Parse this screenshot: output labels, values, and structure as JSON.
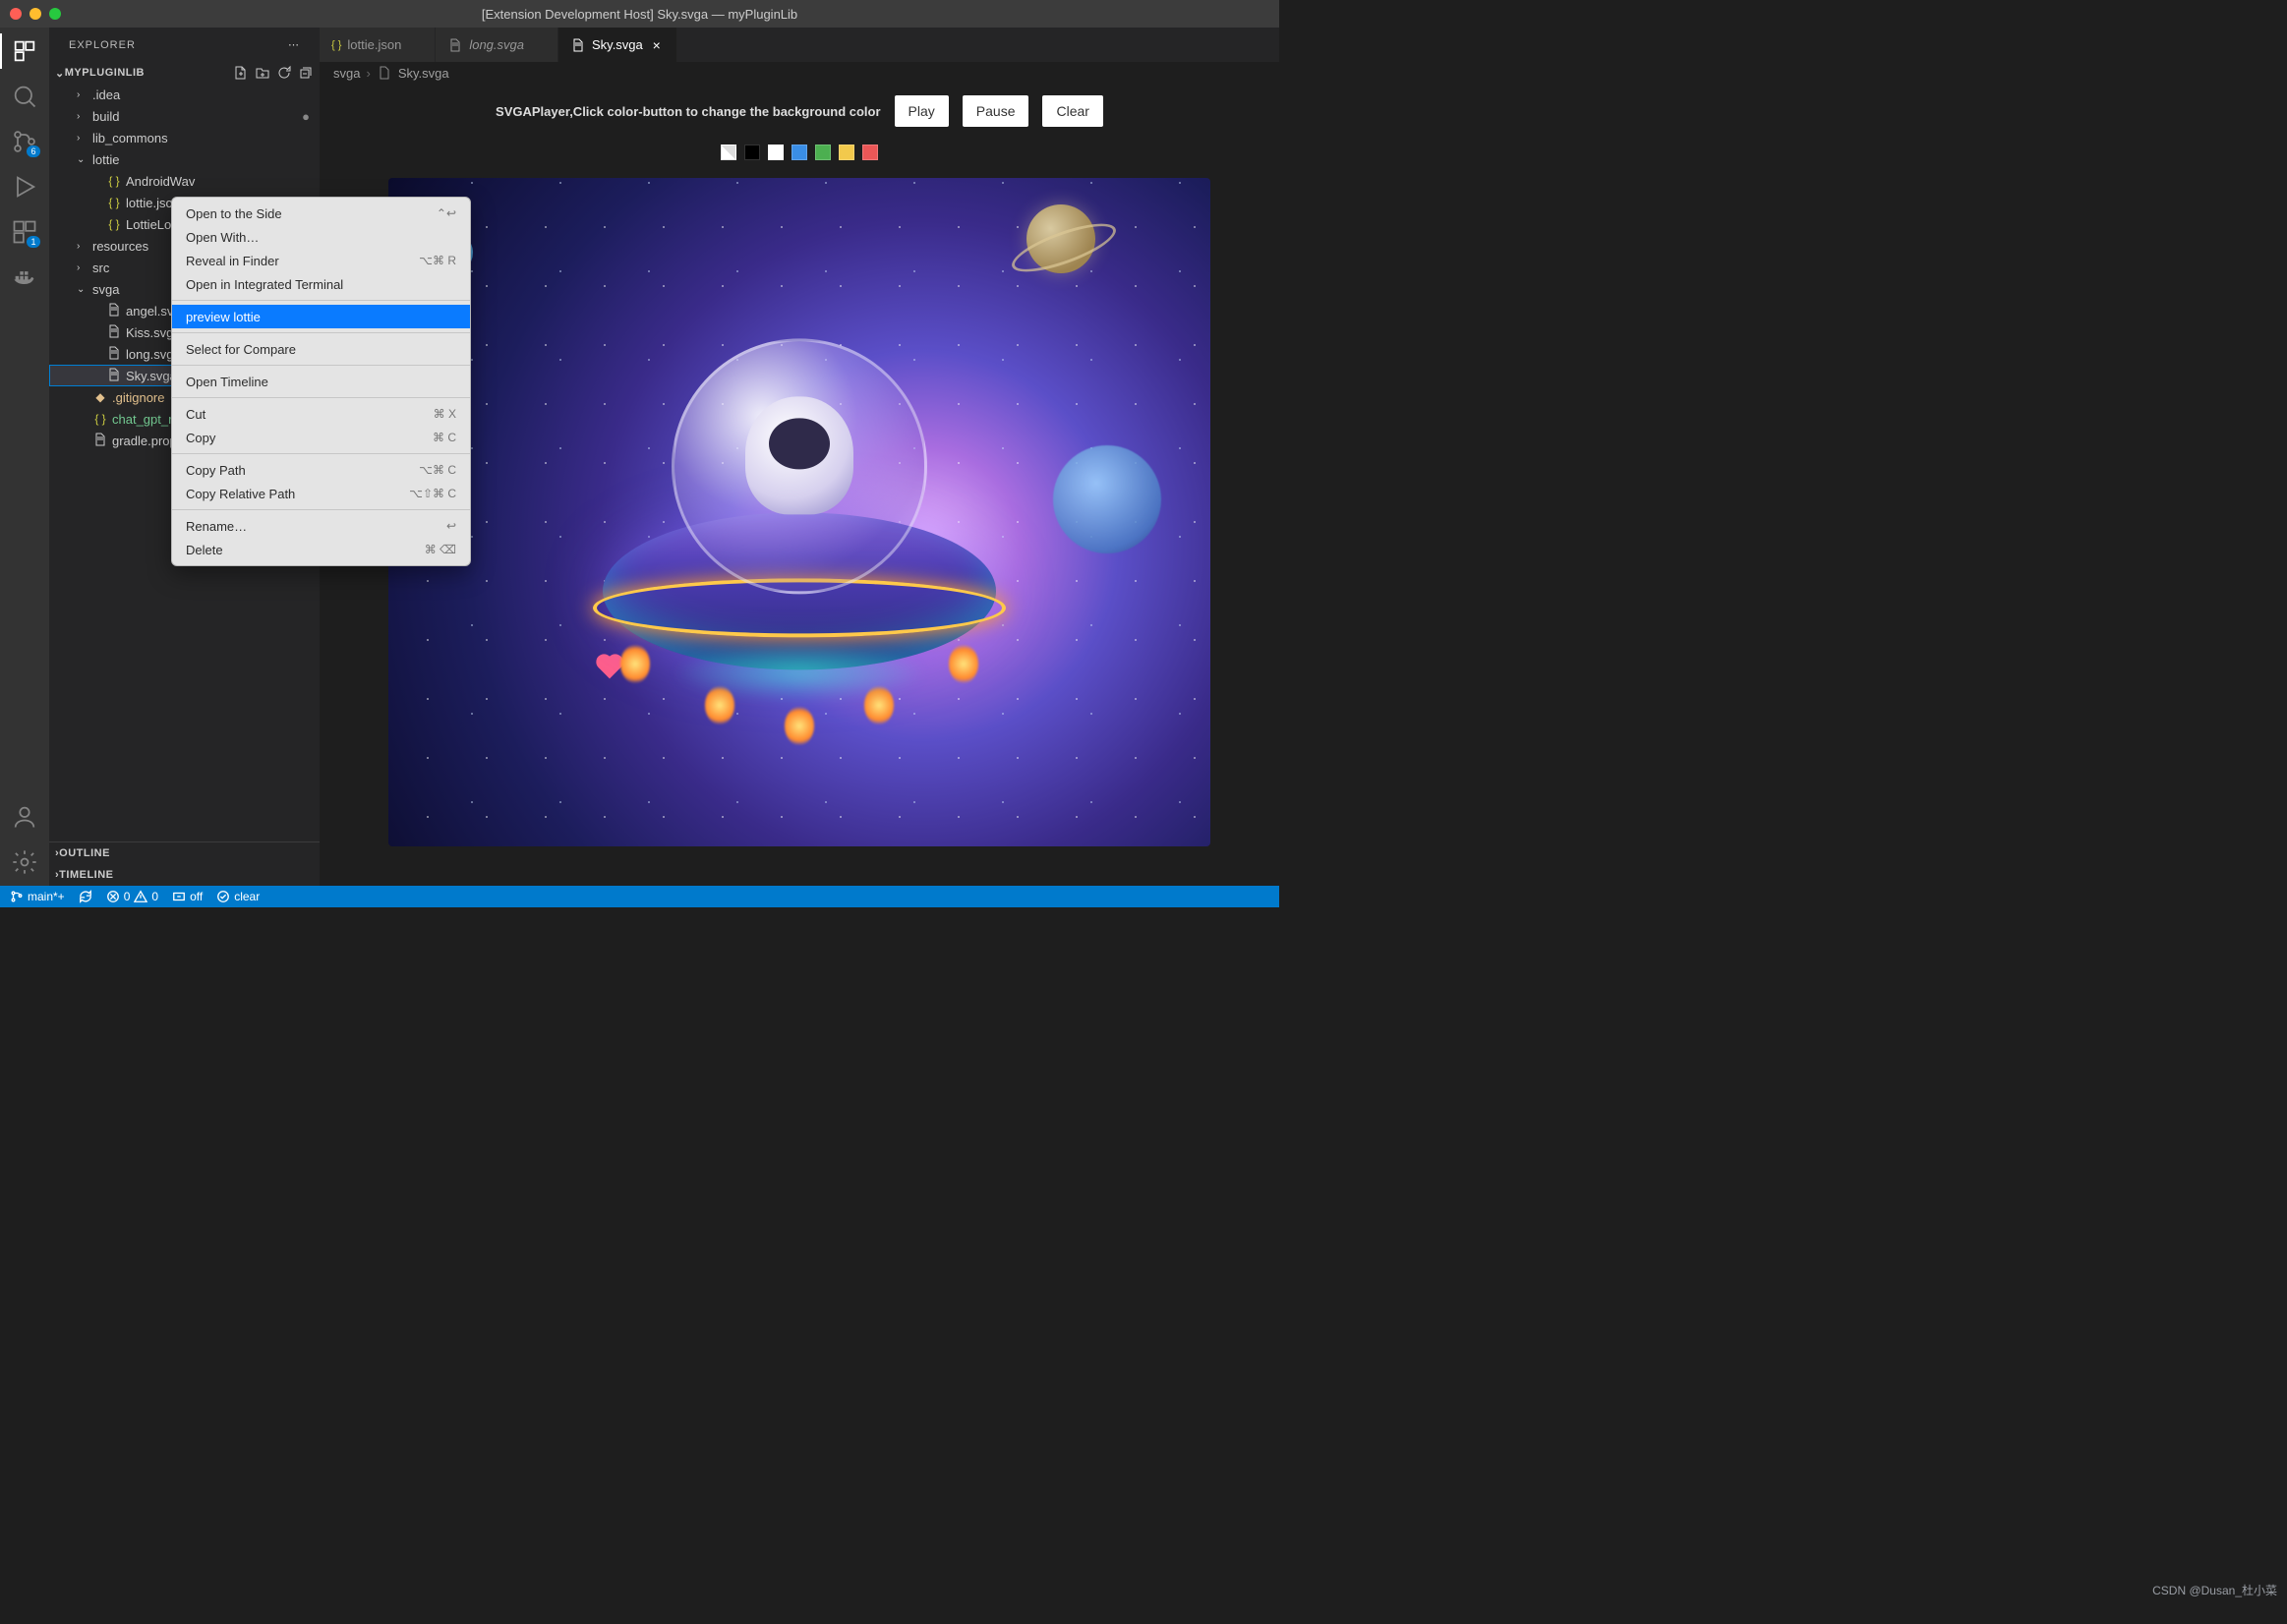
{
  "title": "[Extension Development Host] Sky.svga — myPluginLib",
  "sidebar": {
    "title": "EXPLORER",
    "project": "MYPLUGINLIB",
    "outline": "OUTLINE",
    "timeline": "TIMELINE",
    "tree": [
      {
        "label": ".idea",
        "type": "folder",
        "indent": 1
      },
      {
        "label": "build",
        "type": "folder",
        "indent": 1,
        "modified": true
      },
      {
        "label": "lib_commons",
        "type": "folder",
        "indent": 1
      },
      {
        "label": "lottie",
        "type": "folder-open",
        "indent": 1
      },
      {
        "label": "AndroidWave.json",
        "type": "json",
        "indent": 2,
        "truncated": "AndroidWav"
      },
      {
        "label": "lottie.json",
        "type": "json",
        "indent": 2
      },
      {
        "label": "LottieLogo1.json",
        "type": "json",
        "indent": 2,
        "truncated": "LottieLogo1"
      },
      {
        "label": "resources",
        "type": "folder",
        "indent": 1
      },
      {
        "label": "src",
        "type": "folder",
        "indent": 1
      },
      {
        "label": "svga",
        "type": "folder-open",
        "indent": 1
      },
      {
        "label": "angel.svga",
        "type": "file",
        "indent": 2
      },
      {
        "label": "Kiss.svga",
        "type": "file",
        "indent": 2
      },
      {
        "label": "long.svga",
        "type": "file",
        "indent": 2
      },
      {
        "label": "Sky.svga",
        "type": "file",
        "indent": 2,
        "selected": true
      },
      {
        "label": ".gitignore",
        "type": "git",
        "indent": 1,
        "color": "orange"
      },
      {
        "label": "chat_gpt_response.json",
        "type": "json",
        "indent": 1,
        "color": "green",
        "truncated": "chat_gpt_res"
      },
      {
        "label": "gradle.properties",
        "type": "file",
        "indent": 1,
        "truncated": "gradle.prope"
      }
    ]
  },
  "activity": {
    "scm_badge": "6",
    "ext_badge": "1"
  },
  "tabs": [
    {
      "label": "lottie.json",
      "icon": "json"
    },
    {
      "label": "long.svga",
      "icon": "file",
      "italic": true
    },
    {
      "label": "Sky.svga",
      "icon": "file",
      "active": true
    }
  ],
  "breadcrumb": {
    "parts": [
      "svga",
      "Sky.svga"
    ]
  },
  "player": {
    "text": "SVGAPlayer,Click color-button to change the background color",
    "play": "Play",
    "pause": "Pause",
    "clear": "Clear",
    "swatches": [
      "#ffffff",
      "#000000",
      "#ffffff",
      "#3a8ee6",
      "#4caf50",
      "#f2c94c",
      "#eb5757"
    ]
  },
  "context_menu": [
    {
      "label": "Open to the Side",
      "shortcut": "⌃↩"
    },
    {
      "label": "Open With…"
    },
    {
      "label": "Reveal in Finder",
      "shortcut": "⌥⌘ R"
    },
    {
      "label": "Open in Integrated Terminal"
    },
    {
      "sep": true
    },
    {
      "label": "preview lottie",
      "highlight": true
    },
    {
      "sep": true
    },
    {
      "label": "Select for Compare"
    },
    {
      "sep": true
    },
    {
      "label": "Open Timeline"
    },
    {
      "sep": true
    },
    {
      "label": "Cut",
      "shortcut": "⌘ X"
    },
    {
      "label": "Copy",
      "shortcut": "⌘ C"
    },
    {
      "sep": true
    },
    {
      "label": "Copy Path",
      "shortcut": "⌥⌘ C"
    },
    {
      "label": "Copy Relative Path",
      "shortcut": "⌥⇧⌘ C"
    },
    {
      "sep": true
    },
    {
      "label": "Rename…",
      "shortcut": "↩"
    },
    {
      "label": "Delete",
      "shortcut": "⌘ ⌫"
    }
  ],
  "statusbar": {
    "branch": "main*+",
    "errors": "0",
    "warnings": "0",
    "ext1": "off",
    "ext2": "clear"
  },
  "watermark": "CSDN @Dusan_杜小菜"
}
